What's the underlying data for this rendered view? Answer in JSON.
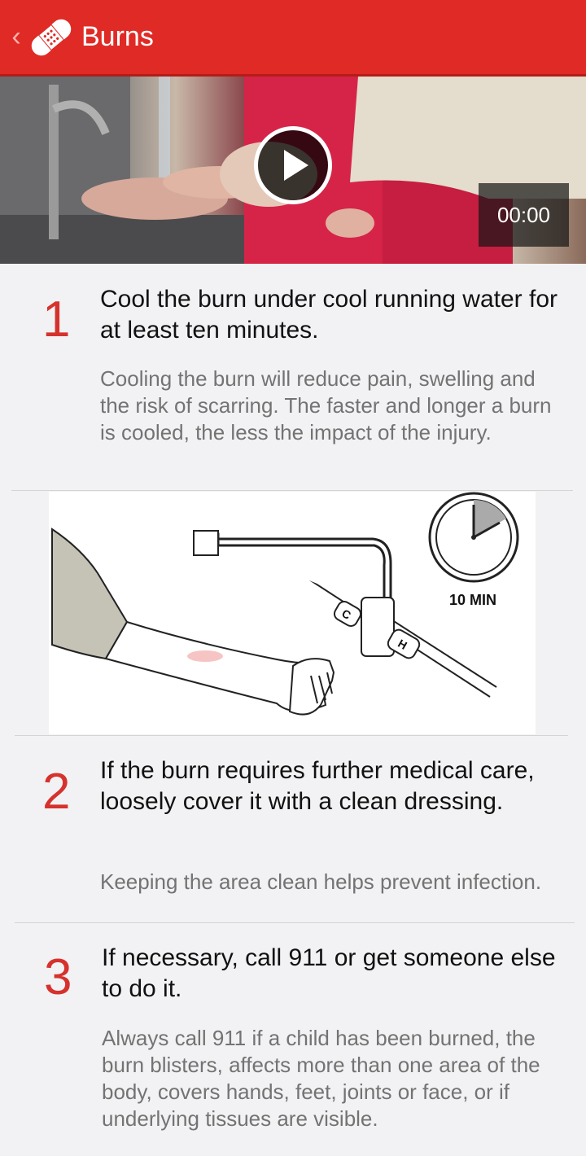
{
  "appbar": {
    "title": "Burns",
    "back_icon": "chevron-left-icon",
    "logo_icon": "bandage-icon",
    "color": "#e02a25"
  },
  "video": {
    "time": "00:00",
    "play_icon": "play-icon"
  },
  "steps": [
    {
      "number": "1",
      "title": "Cool the burn under cool running water for at least ten minutes.",
      "description": "Cooling the burn will reduce pain, swelling and the risk of scarring. The faster and longer a burn is cooled, the less the impact of the injury."
    },
    {
      "number": "2",
      "title": "If the burn requires further medical care, loosely cover it with a clean dressing.",
      "description": "Keeping the area clean helps prevent infection."
    },
    {
      "number": "3",
      "title": "If necessary, call 911 or get someone else to do it.",
      "description": "Always call 911 if a child has been burned, the burn blisters, affects more than one area of the body, covers hands, feet, joints or face, or if underlying tissues are visible."
    }
  ],
  "illustration": {
    "timer_label": "10 MIN",
    "tap_cold": "C",
    "tap_hot": "H"
  },
  "accent_color": "#d6322d"
}
